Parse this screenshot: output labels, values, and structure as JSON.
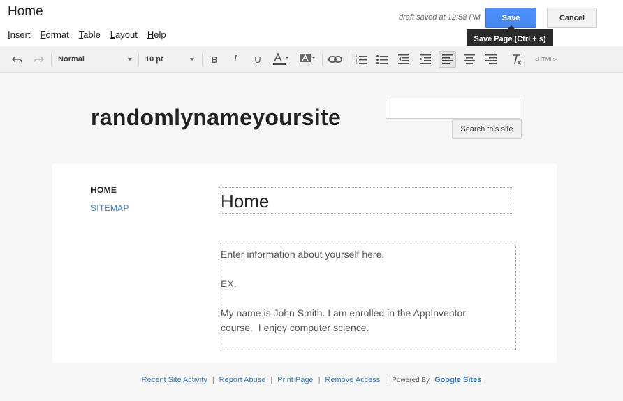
{
  "header": {
    "title": "Home",
    "draft_status": "draft saved at 12:58 PM",
    "save_label": "Save",
    "cancel_label": "Cancel",
    "save_tooltip": "Save Page (Ctrl + s)"
  },
  "menu": {
    "items": [
      {
        "underline": "I",
        "rest": "nsert"
      },
      {
        "underline": "F",
        "rest": "ormat"
      },
      {
        "underline": "T",
        "rest": "able"
      },
      {
        "underline": "L",
        "rest": "ayout"
      },
      {
        "underline": "H",
        "rest": "elp"
      }
    ]
  },
  "toolbar": {
    "style_select": "Normal",
    "size_select": "10 pt",
    "html_label": "<HTML>",
    "icons": [
      "undo-icon",
      "redo-icon",
      "bold-icon",
      "italic-icon",
      "underline-icon",
      "text-color-icon",
      "highlight-color-icon",
      "link-icon",
      "numbered-list-icon",
      "bullet-list-icon",
      "outdent-icon",
      "indent-icon",
      "align-left-icon",
      "align-center-icon",
      "align-right-icon",
      "remove-formatting-icon"
    ]
  },
  "site": {
    "name": "randomlynameyoursite",
    "search_button": "Search this site",
    "search_value": ""
  },
  "nav": {
    "home": "HOME",
    "sitemap": "SITEMAP"
  },
  "page": {
    "heading": "Home",
    "body_lines": [
      "Enter information about yourself here.",
      "",
      "EX.",
      "",
      "My name is John Smith. I am enrolled in the AppInventor",
      "course.  I enjoy computer science."
    ]
  },
  "footer": {
    "links": [
      "Recent Site Activity",
      "Report Abuse",
      "Print Page",
      "Remove Access"
    ],
    "powered_by": "Powered By",
    "brand": "Google Sites"
  },
  "colors": {
    "save_blue": "#4d90fe",
    "link_blue": "#3b7cbf",
    "tooltip_bg": "#2a2a2a"
  }
}
